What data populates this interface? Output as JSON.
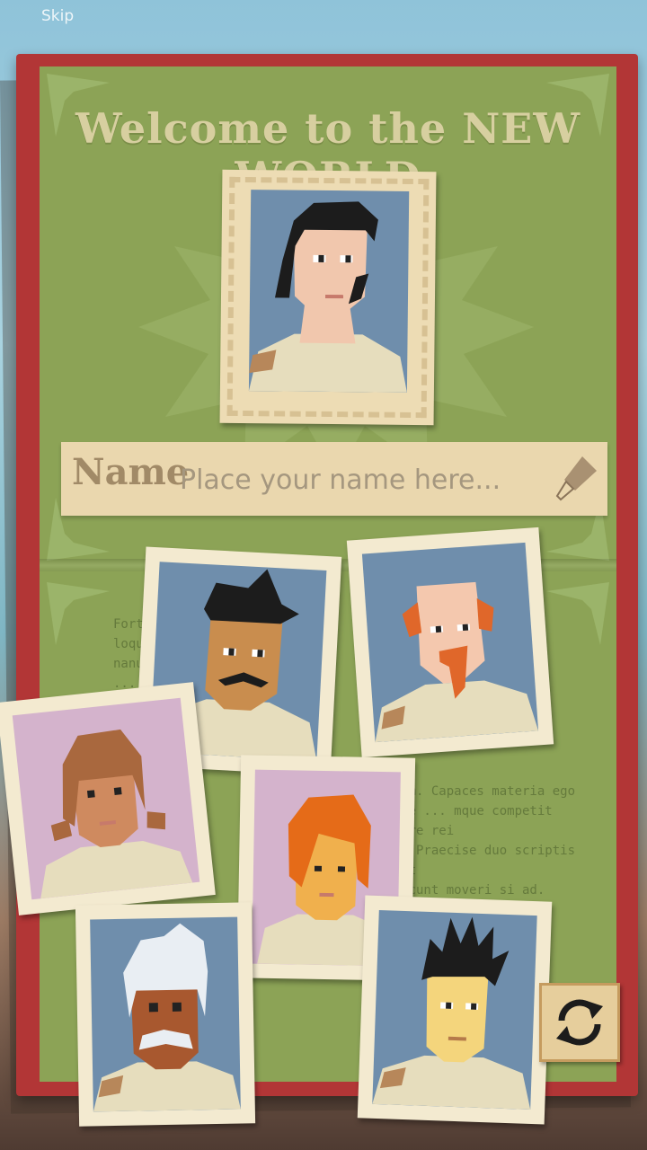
{
  "skip_label": "Skip",
  "title": "Welcome to the NEW WORLD",
  "name_field": {
    "label": "Name",
    "value": "",
    "placeholder": "Place your name here..."
  },
  "background_text": [
    "Fortunate ... um ... ole",
    "loque ... vam ... ev",
    "nanu ... ora",
    "... um ... tum",
    "... rum. Capaces materia ego",
    "... ppe ... mque competit reperire rei",
    "... e. Praecise duo scriptis tum est",
    "... dicunt moveri si ad.",
    "... um hauriuntur in et"
  ],
  "characters": [
    {
      "id": "selected",
      "hair": "#1c1c1c",
      "skin": "#f1c7ad",
      "bg": "#6f8eac"
    },
    {
      "id": "mustache",
      "hair": "#1c1c1c",
      "skin": "#c98d4e",
      "bg": "#6f8eac"
    },
    {
      "id": "bald-ginger",
      "hair": "#e0672a",
      "skin": "#f4c8ae",
      "bg": "#6f8eac"
    },
    {
      "id": "braids",
      "hair": "#a9683e",
      "skin": "#cf8a5f",
      "bg": "#d4b3cc"
    },
    {
      "id": "redhead",
      "hair": "#e56b18",
      "skin": "#f0b04d",
      "bg": "#d4b3cc"
    },
    {
      "id": "old-white",
      "hair": "#e9eef3",
      "skin": "#a8582f",
      "bg": "#6f8eac"
    },
    {
      "id": "spiky",
      "hair": "#1c1c1c",
      "skin": "#f4d57c",
      "bg": "#6f8eac"
    }
  ],
  "colors": {
    "book_red": "#b23636",
    "page_green": "#8ca356",
    "title_cream": "#d7cfa0",
    "frame_cream": "#f3ead0"
  },
  "icons": {
    "pen": "fountain-pen-icon",
    "refresh": "refresh-icon"
  }
}
